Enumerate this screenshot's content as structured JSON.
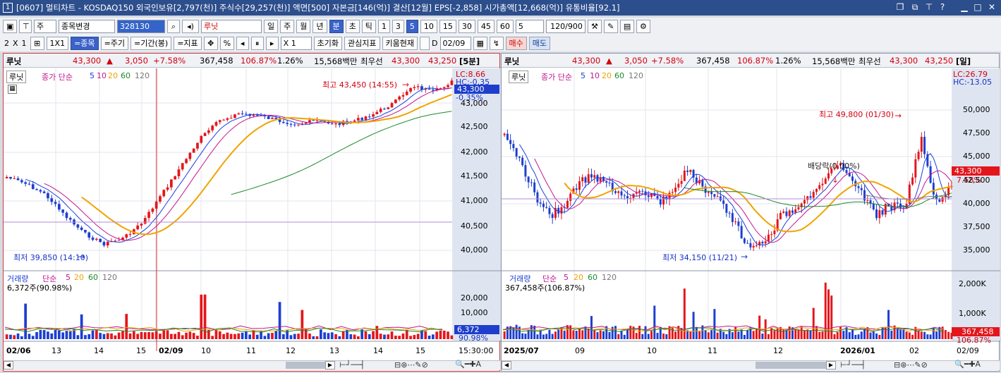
{
  "title": {
    "num": "1",
    "text": "[0607] 멀티차트 - KOSDAQ150 외국인보유[2,797(천)] 주식수[29,257(천)] 액면[500] 자본금[146(억)] 결산[12월] EPS[-2,858] 시가총액[12,668(억)] 유통비율[92.1]"
  },
  "toolbar1": {
    "market": "주",
    "change_label": "종목변경",
    "code": "328130",
    "stock_name": "루닛",
    "periods": [
      "일",
      "주",
      "월",
      "년",
      "분",
      "초",
      "틱"
    ],
    "intervals": [
      "1",
      "3",
      "5",
      "10",
      "15",
      "30",
      "45",
      "60"
    ],
    "count": "5",
    "range": "120/900"
  },
  "toolbar2": {
    "layout_rows": "2",
    "layout_x": "X",
    "layout_cols": "1",
    "one_by_one": "1X1",
    "btn_stock": "=종목",
    "btn_period": "=주기",
    "btn_range": "=기간(봉)",
    "btn_indicator": "=지표",
    "btn_pct": "%",
    "zoom": "X 1",
    "btn_init": "초기화",
    "btn_watch": "관심지표",
    "btn_kiwoom": "키움현재",
    "date_chk": "D",
    "date": "02/09",
    "btn_buy": "매수",
    "btn_sell": "매도"
  },
  "left": {
    "header": {
      "name": "루닛",
      "price": "43,300",
      "arrow": "▲",
      "change": "3,050",
      "pct": "+7.58%",
      "volume": "367,458",
      "vol_pct": "106.87%",
      "turnover": "1.26%",
      "amount": "15,568백만",
      "best_label": "최우선",
      "ask": "43,300",
      "bid": "43,250",
      "period": "[5분]"
    },
    "legend": {
      "stock": "루닛",
      "price_label": "종가 단순",
      "ma": [
        "5",
        "10",
        "20",
        "60",
        "120"
      ]
    },
    "lc": "LC:8.66",
    "hc": "HC:-0.35",
    "cur_price": "43,300",
    "cur_pct": "-0.35%",
    "high": "최고 43,450 (14:55)",
    "low": "최저 39,850 (14:10)",
    "yticks": [
      "43,000",
      "42,500",
      "42,000",
      "41,500",
      "41,000",
      "40,500",
      "40,000"
    ],
    "vol_legend": {
      "label": "거래량",
      "ma_label": "단순",
      "ma": [
        "5",
        "20",
        "60",
        "120"
      ]
    },
    "vol_value": "6,372주(90.98%)",
    "vol_ticks": [
      "20,000",
      "10,000"
    ],
    "vol_cur": "6,372",
    "vol_pct": "90.98%",
    "xticks": [
      "02/06",
      "13",
      "14",
      "15",
      "02/09",
      "10",
      "11",
      "12",
      "13",
      "14",
      "15"
    ],
    "time": "15:30:00"
  },
  "right": {
    "header": {
      "name": "루닛",
      "price": "43,300",
      "arrow": "▲",
      "change": "3,050",
      "pct": "+7.58%",
      "volume": "367,458",
      "vol_pct": "106.87%",
      "turnover": "1.26%",
      "amount": "15,568백만",
      "best_label": "최우선",
      "ask": "43,300",
      "bid": "43,250",
      "period": "[일]"
    },
    "legend": {
      "stock": "루닛",
      "price_label": "종가 단순",
      "ma": [
        "5",
        "10",
        "20",
        "60",
        "120"
      ]
    },
    "lc": "LC:26.79",
    "hc": "HC:-13.05",
    "cur_price": "43,300",
    "cur_pct": "7.58%",
    "high": "최고 49,800 (01/30)",
    "low": "최저 34,150 (11/21)",
    "dividend": "배당락(0.00%)",
    "yticks": [
      "50,000",
      "47,500",
      "45,000",
      "42,500",
      "40,000",
      "37,500",
      "35,000"
    ],
    "vol_legend": {
      "label": "거래량",
      "ma_label": "단순",
      "ma": [
        "5",
        "20",
        "60",
        "120"
      ]
    },
    "vol_value": "367,458주(106.87%)",
    "vol_ticks": [
      "2,000K",
      "1,000K"
    ],
    "vol_cur": "367,458",
    "vol_pct": "106.87%",
    "xticks": [
      "2025/07",
      "09",
      "10",
      "11",
      "12",
      "2026/01",
      "02"
    ],
    "time": "02/09"
  },
  "colors": {
    "up": "#e4161b",
    "down": "#1d3fd0",
    "ma5": "#1a3fe0",
    "ma10": "#c2168f",
    "ma20": "#f0a400",
    "ma60": "#1c8a2c",
    "ma120": "#777777",
    "accent": "#3b62c9"
  }
}
